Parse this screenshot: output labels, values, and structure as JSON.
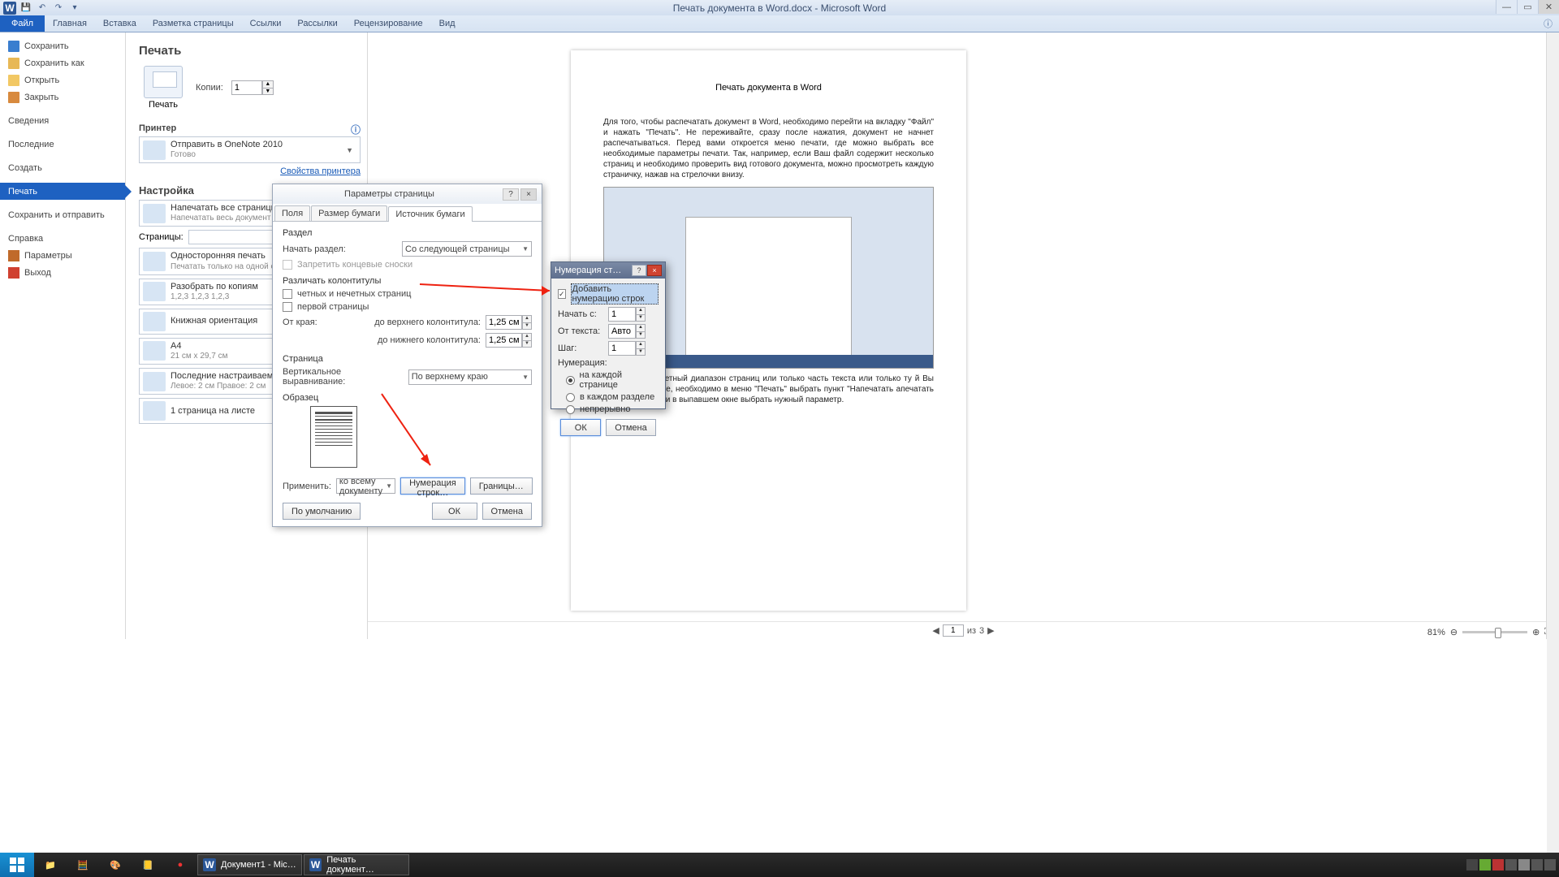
{
  "title": "Печать документа в Word.docx - Microsoft Word",
  "ribbon": {
    "file": "Файл",
    "tabs": [
      "Главная",
      "Вставка",
      "Разметка страницы",
      "Ссылки",
      "Рассылки",
      "Рецензирование",
      "Вид"
    ]
  },
  "backstage": {
    "save": "Сохранить",
    "saveas": "Сохранить как",
    "open": "Открыть",
    "close": "Закрыть",
    "info": "Сведения",
    "recent": "Последние",
    "new": "Создать",
    "print": "Печать",
    "share": "Сохранить и отправить",
    "help": "Справка",
    "options": "Параметры",
    "exit": "Выход"
  },
  "print": {
    "header": "Печать",
    "printbtn": "Печать",
    "copies_lbl": "Копии:",
    "copies_val": "1",
    "printer_h": "Принтер",
    "printer": {
      "name": "Отправить в OneNote 2010",
      "status": "Готово"
    },
    "printer_props": "Свойства принтера",
    "settings_h": "Настройка",
    "opt_allpages": {
      "main": "Напечатать все страницы",
      "sub": "Напечатать весь документ"
    },
    "pages_lbl": "Страницы:",
    "opt_sides": {
      "main": "Односторонняя печать",
      "sub": "Печатать только на одной сторо"
    },
    "opt_collate": {
      "main": "Разобрать по копиям",
      "sub": "1,2,3   1,2,3   1,2,3"
    },
    "opt_orient": {
      "main": "Книжная ориентация",
      "sub": ""
    },
    "opt_size": {
      "main": "A4",
      "sub": "21 см x 29,7 см"
    },
    "opt_margins": {
      "main": "Последние настраиваемые по…",
      "sub": "Левое: 2 см   Правое: 2 см"
    },
    "opt_sheet": {
      "main": "1 страница на листе",
      "sub": ""
    }
  },
  "nav": {
    "page": "1",
    "of_lbl": "из",
    "total": "3",
    "zoom": "81%"
  },
  "dlg1": {
    "title": "Параметры страницы",
    "tabs": [
      "Поля",
      "Размер бумаги",
      "Источник бумаги"
    ],
    "section_h": "Раздел",
    "start_lbl": "Начать раздел:",
    "start_val": "Со следующей страницы",
    "suppress": "Запретить концевые сноски",
    "headers_h": "Различать колонтитулы",
    "chk_oddeven": "четных и нечетных страниц",
    "chk_first": "первой страницы",
    "edge_lbl": "От края:",
    "top_hdr": "до верхнего колонтитула:",
    "bot_hdr": "до нижнего колонтитула:",
    "top_val": "1,25 см",
    "bot_val": "1,25 см",
    "page_h": "Страница",
    "valign_lbl": "Вертикальное выравнивание:",
    "valign_val": "По верхнему краю",
    "sample_h": "Образец",
    "apply_lbl": "Применить:",
    "apply_val": "ко всему документу",
    "linenums_btn": "Нумерация строк…",
    "borders_btn": "Границы…",
    "default_btn": "По умолчанию",
    "ok": "ОК",
    "cancel": "Отмена"
  },
  "dlg2": {
    "title": "Нумерация ст…",
    "chk_add": "Добавить нумерацию строк",
    "start_lbl": "Начать с:",
    "start_val": "1",
    "fromtext_lbl": "От текста:",
    "fromtext_val": "Авто",
    "step_lbl": "Шаг:",
    "step_val": "1",
    "num_h": "Нумерация:",
    "r_page": "на каждой странице",
    "r_sect": "в каждом разделе",
    "r_cont": "непрерывно",
    "ok": "ОК",
    "cancel": "Отмена"
  },
  "preview": {
    "h": "Печать документа в Word",
    "p1": "Для того, чтобы распечатать документ в Word, необходимо перейти на вкладку \"Файл\" и нажать \"Печать\". Не переживайте, сразу после нажатия, документ не начнет распечатываться. Перед вами откроется меню печати, где можно выбрать все необходимые параметры печати. Так, например, если Ваш файл содержит несколько страниц и необходимо проверить вид готового документа, можно просмотреть каждую страничку, нажав на стрелочки внизу.",
    "p2": "апечатать конкретный диапазон страниц или только часть текста или только ту й Вы сейчас работаете, необходимо в меню \"Печать\" выбрать пункт \"Напечатать апечатать весь документ\") и в выпавшем окне выбрать нужный параметр."
  },
  "taskbar": {
    "task1": "Документ1 - Mic…",
    "task2": "Печать документ…"
  }
}
